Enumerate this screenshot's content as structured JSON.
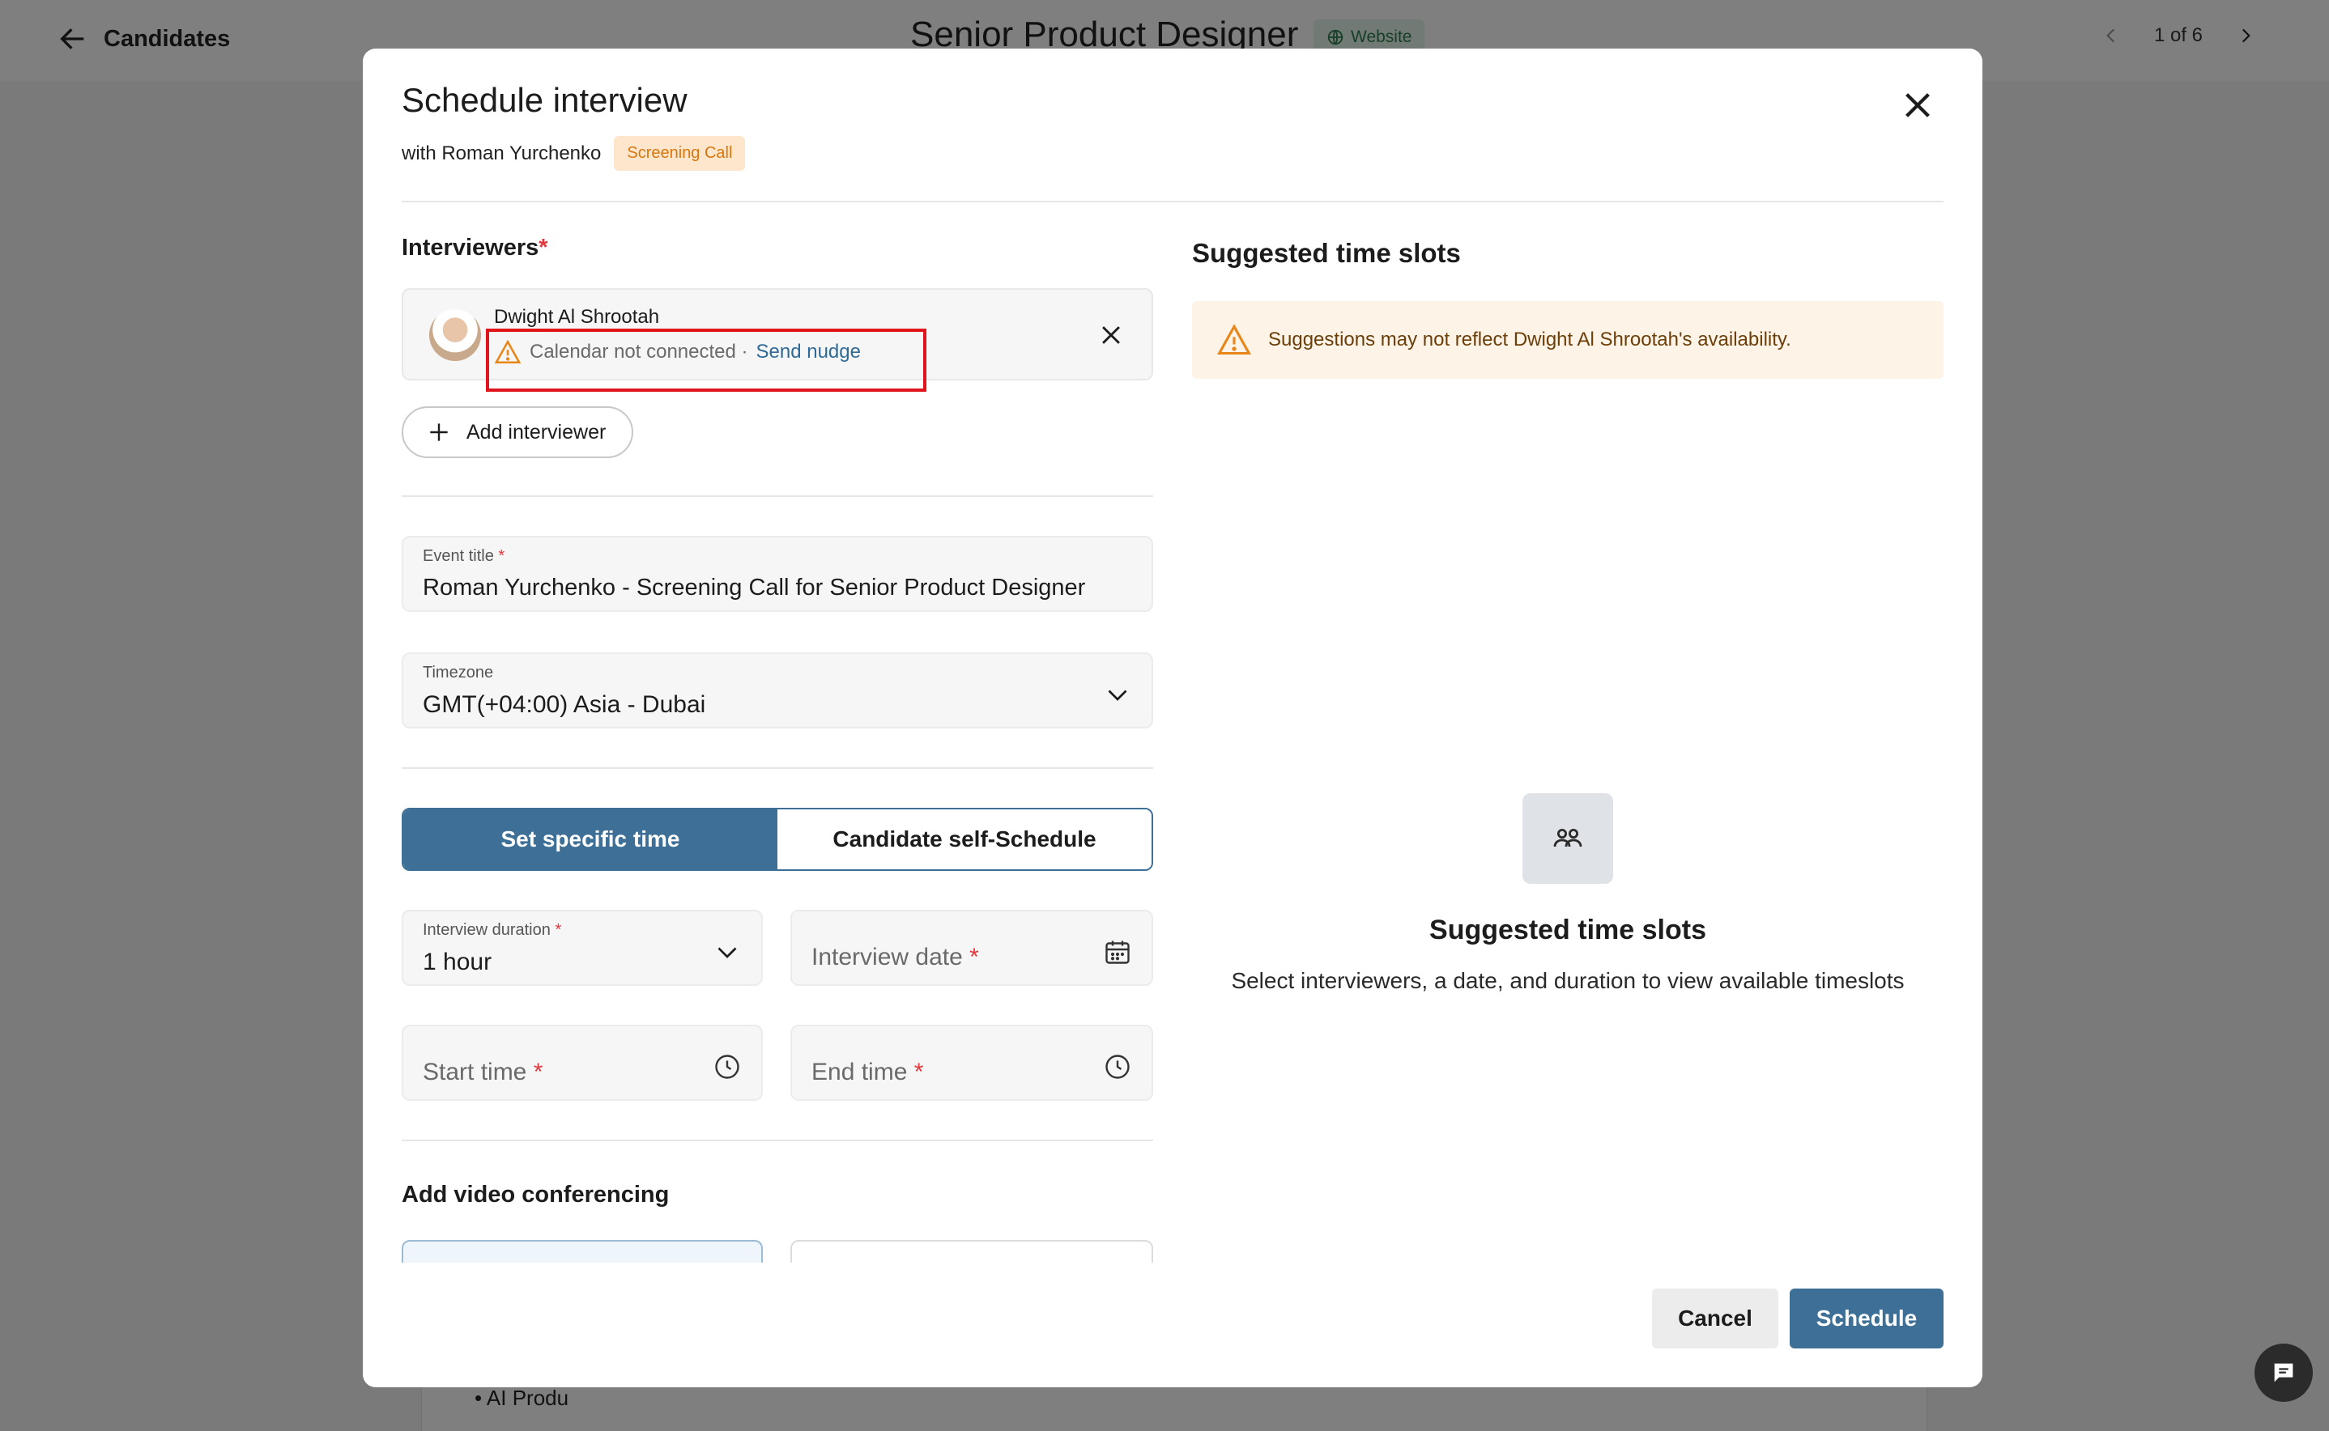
{
  "background": {
    "back_label": "Candidates",
    "job_title": "Senior Product Designer",
    "source_badge": "Website",
    "pager": "1 of 6",
    "list_item": "AI Produ"
  },
  "modal": {
    "title": "Schedule interview",
    "with_prefix": "with Roman Yurchenko",
    "stage_tag": "Screening Call",
    "interviewers_label": "Interviewers",
    "required_mark": "*",
    "interviewer": {
      "name": "Dwight Al Shrootah",
      "status": "Calendar not connected ·",
      "nudge": "Send nudge"
    },
    "add_interviewer": "Add interviewer",
    "event_title": {
      "label": "Event title",
      "value": "Roman Yurchenko - Screening Call for Senior Product Designer"
    },
    "timezone": {
      "label": "Timezone",
      "value": "GMT(+04:00) Asia - Dubai"
    },
    "schedule_mode": {
      "options": [
        "Set specific time",
        "Candidate self-Schedule"
      ],
      "selected": "Set specific time"
    },
    "duration": {
      "label": "Interview duration",
      "value": "1 hour"
    },
    "date": {
      "placeholder": "Interview date"
    },
    "start_time": {
      "placeholder": "Start time"
    },
    "end_time": {
      "placeholder": "End time"
    },
    "video_label": "Add video conferencing",
    "suggested": {
      "heading": "Suggested time slots",
      "warning": "Suggestions may not reflect Dwight Al Shrootah's availability.",
      "empty_title": "Suggested time slots",
      "empty_sub": "Select interviewers, a date, and duration to view available timeslots"
    },
    "buttons": {
      "cancel": "Cancel",
      "schedule": "Schedule"
    }
  },
  "colors": {
    "primary": "#3e6f96",
    "warning": "#e8861a",
    "required": "#e0393e",
    "highlight": "#e0141b"
  }
}
